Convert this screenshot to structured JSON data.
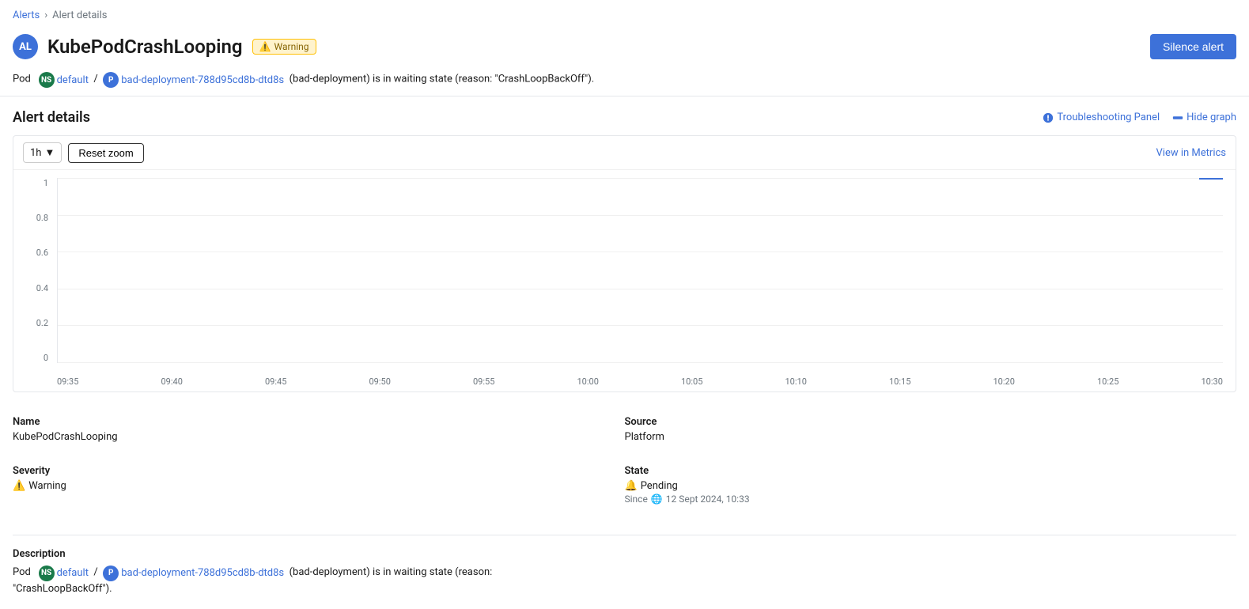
{
  "breadcrumb": {
    "parent": "Alerts",
    "current": "Alert details"
  },
  "header": {
    "avatar_text": "AL",
    "title": "KubePodCrashLooping",
    "badge_label": "Warning",
    "silence_btn": "Silence alert"
  },
  "pod_info": {
    "prefix": "Pod",
    "ns_badge": "NS",
    "ns_link": "default",
    "p_badge": "P",
    "pod_link": "bad-deployment-788d95cd8b-dtd8s",
    "description": "(bad-deployment) is in waiting state (reason: \"CrashLoopBackOff\")."
  },
  "alert_details_section": {
    "title": "Alert details",
    "troubleshooting_label": "Troubleshooting Panel",
    "hide_graph_label": "Hide graph"
  },
  "graph": {
    "time_range": "1h",
    "reset_zoom": "Reset zoom",
    "view_metrics": "View in Metrics",
    "y_labels": [
      "1",
      "0.8",
      "0.6",
      "0.4",
      "0.2",
      "0"
    ],
    "x_labels": [
      "09:35",
      "09:40",
      "09:45",
      "09:50",
      "09:55",
      "10:00",
      "10:05",
      "10:10",
      "10:15",
      "10:20",
      "10:25",
      "10:30"
    ]
  },
  "details": {
    "name_label": "Name",
    "name_value": "KubePodCrashLooping",
    "source_label": "Source",
    "source_value": "Platform",
    "severity_label": "Severity",
    "severity_value": "Warning",
    "state_label": "State",
    "state_value": "Pending",
    "state_since_prefix": "Since",
    "state_since": "12 Sept 2024, 10:33"
  },
  "description": {
    "label": "Description",
    "ns_badge": "NS",
    "ns_link": "default",
    "p_badge": "P",
    "pod_link": "bad-deployment-788d95cd8b-dtd8s",
    "text1": "Pod",
    "text2": "(bad-deployment) is in waiting state (reason:",
    "text3": "\"CrashLoopBackOff\")."
  }
}
